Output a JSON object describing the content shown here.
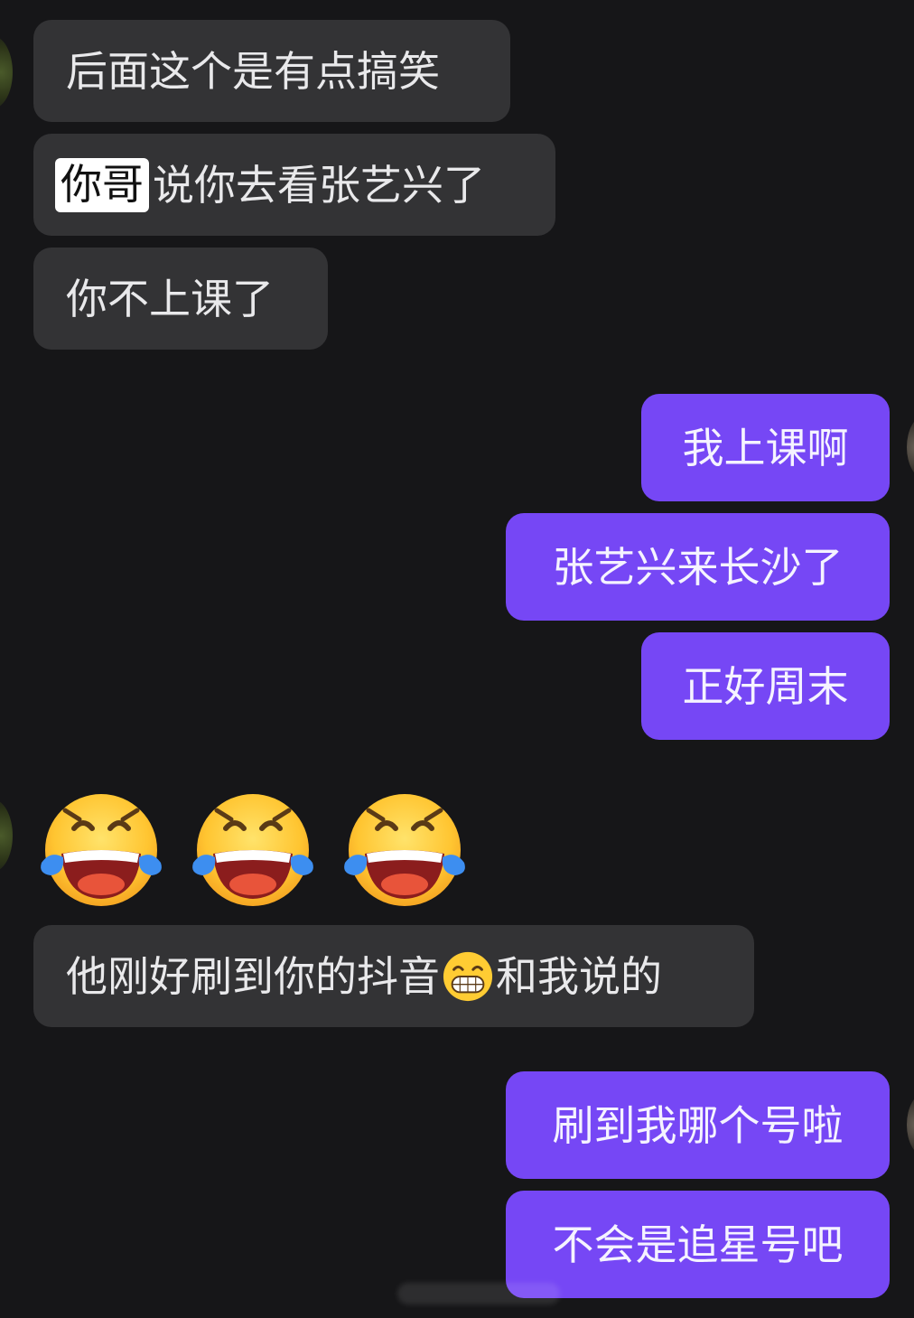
{
  "messages_incoming_1": [
    {
      "text_prefix": "",
      "text": "后面这个是有点搞笑"
    },
    {
      "highlight": "你哥",
      "text": "说你去看张艺兴了"
    },
    {
      "text": "你不上课了"
    }
  ],
  "messages_outgoing_1": [
    {
      "text": "我上课啊"
    },
    {
      "text": "张艺兴来长沙了"
    },
    {
      "text": "正好周末"
    }
  ],
  "emoji_message": {
    "icons": [
      "face-with-tears-of-joy-icon",
      "face-with-tears-of-joy-icon",
      "face-with-tears-of-joy-icon"
    ]
  },
  "message_incoming_4": {
    "text_before": "他刚好刷到你的抖音",
    "icon": "grinning-face-icon",
    "text_after": "和我说的"
  },
  "messages_outgoing_2": [
    {
      "text": "刷到我哪个号啦"
    },
    {
      "text": "不会是追星号吧"
    }
  ],
  "colors": {
    "background": "#161618",
    "incoming_bubble": "#333335",
    "outgoing_bubble": "#7647f5",
    "highlight": "#ffffff"
  }
}
